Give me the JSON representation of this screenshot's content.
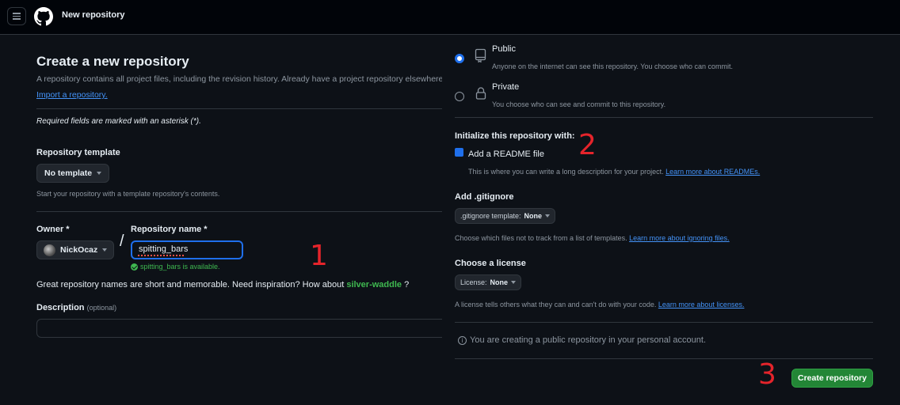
{
  "header": {
    "title": "New repository"
  },
  "page": {
    "title": "Create a new repository",
    "subtitle": "A repository contains all project files, including the revision history. Already have a project repository elsewhere?",
    "import_link": "Import a repository.",
    "required_note": "Required fields are marked with an asterisk (*)."
  },
  "template": {
    "label": "Repository template",
    "selected": "No template",
    "help": "Start your repository with a template repository's contents."
  },
  "owner": {
    "label": "Owner *",
    "value": "NickOcaz"
  },
  "repo_name": {
    "label": "Repository name *",
    "value": "spitting_bars",
    "availability": "spitting_bars is available."
  },
  "inspiration": {
    "text": "Great repository names are short and memorable. Need inspiration? How about",
    "suggestion": "silver-waddle",
    "suffix": "?"
  },
  "description": {
    "label": "Description",
    "optional": "(optional)"
  },
  "visibility": {
    "options": [
      {
        "title": "Public",
        "desc": "Anyone on the internet can see this repository. You choose who can commit.",
        "selected": true,
        "icon": "repo-icon"
      },
      {
        "title": "Private",
        "desc": "You choose who can see and commit to this repository.",
        "selected": false,
        "icon": "lock-icon"
      }
    ]
  },
  "initialize": {
    "heading": "Initialize this repository with:",
    "readme_label": "Add a README file",
    "readme_checked": true,
    "readme_help": "This is where you can write a long description for your project.",
    "readme_link": "Learn more about READMEs."
  },
  "gitignore": {
    "label": "Add .gitignore",
    "dropdown_prefix": ".gitignore template:",
    "dropdown_value": "None",
    "help": "Choose which files not to track from a list of templates.",
    "help_link": "Learn more about ignoring files."
  },
  "license": {
    "label": "Choose a license",
    "dropdown_prefix": "License:",
    "dropdown_value": "None",
    "help": "A license tells others what they can and can't do with your code.",
    "help_link": "Learn more about licenses."
  },
  "info_note": "You are creating a public repository in your personal account.",
  "create_button": "Create repository",
  "annotations": [
    "1",
    "2",
    "3"
  ],
  "colors": {
    "background": "#0d1117",
    "header": "#010409",
    "accent_blue": "#1f6feb",
    "link": "#4493f8",
    "success_green": "#238636",
    "annotation_red": "#e5242b"
  }
}
